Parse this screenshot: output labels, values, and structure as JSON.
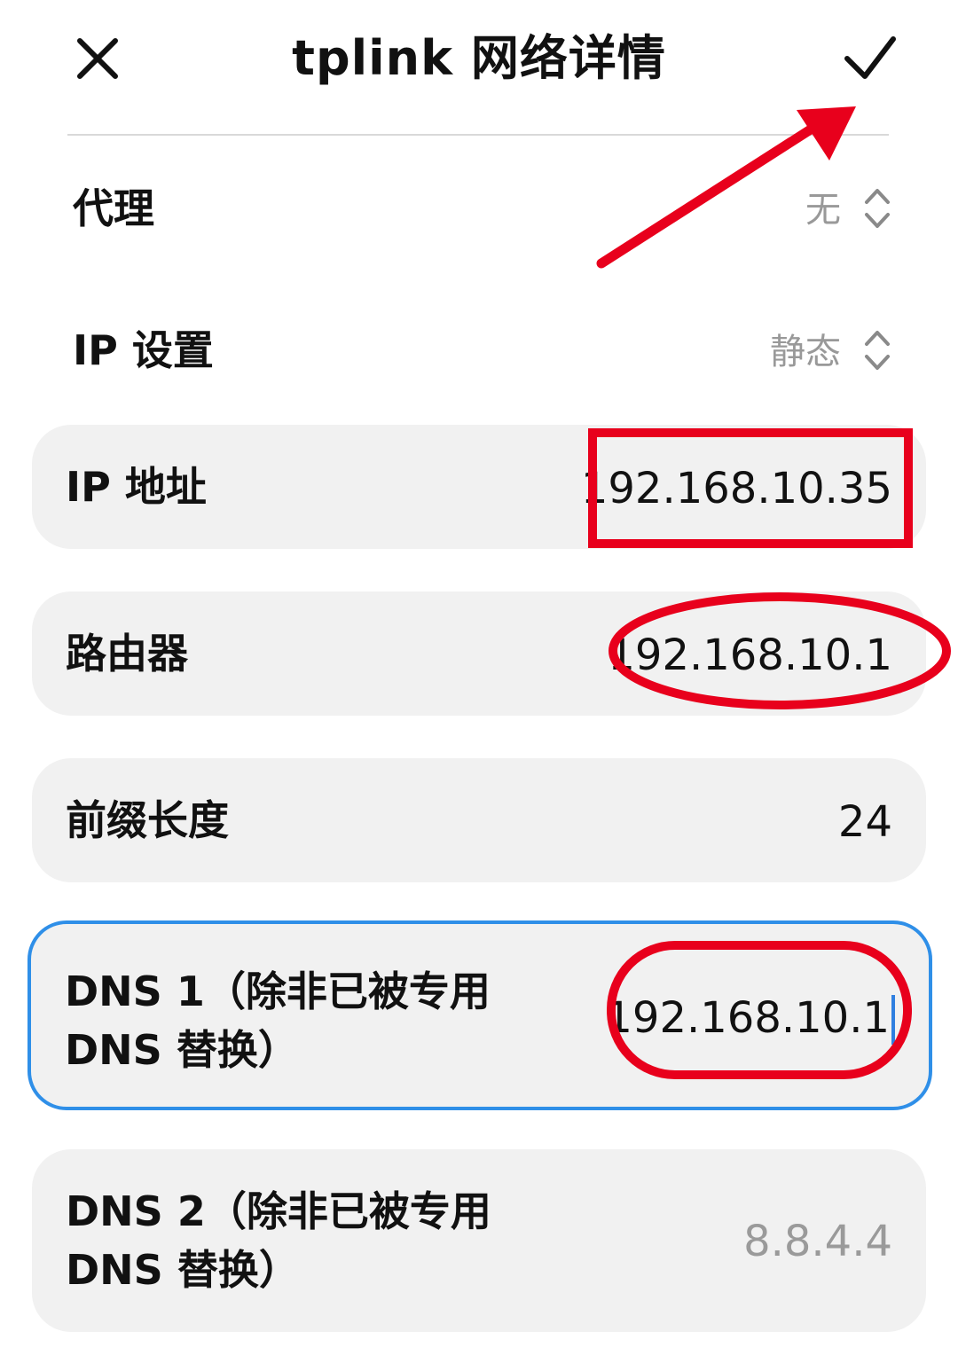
{
  "header": {
    "title": "tplink 网络详情",
    "close_icon": "close-icon",
    "confirm_icon": "checkmark-icon"
  },
  "settings": {
    "proxy": {
      "label": "代理",
      "value": "无",
      "icon": "up-down-chevron-icon"
    },
    "ip_settings": {
      "label": "IP 设置",
      "value": "静态",
      "icon": "up-down-chevron-icon"
    }
  },
  "fields": {
    "ip_address": {
      "label": "IP 地址",
      "value": "192.168.10.35"
    },
    "gateway": {
      "label": "路由器",
      "value": "192.168.10.1"
    },
    "prefix_length": {
      "label": "前缀长度",
      "value": "24"
    },
    "dns1": {
      "label_line1": "DNS 1（除非已被专用",
      "label_line2": "DNS 替换）",
      "value": "192.168.10.1"
    },
    "dns2": {
      "label_line1": "DNS 2（除非已被专用",
      "label_line2": "DNS 替换）",
      "placeholder": "8.8.4.4"
    }
  },
  "colors": {
    "annotation": "#e8001c",
    "focus_border": "#2f8fe8",
    "card_background": "#f1f1f1",
    "muted_text": "#999999"
  }
}
